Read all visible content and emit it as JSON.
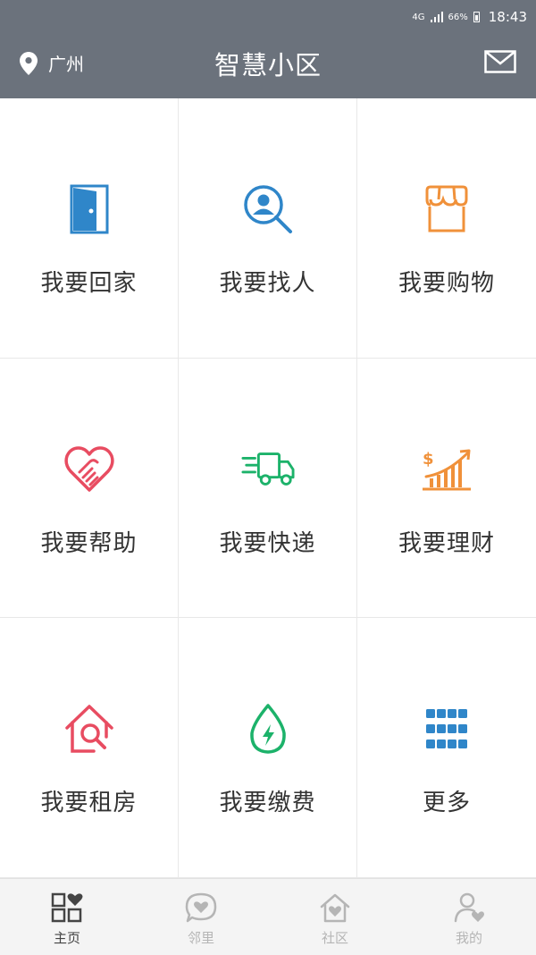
{
  "status_bar": {
    "network": "4G",
    "battery": "66%",
    "time": "18:43"
  },
  "header": {
    "location": "广州",
    "title": "智慧小区",
    "mail_icon": "mail-icon",
    "location_icon": "location-pin-icon"
  },
  "grid": [
    {
      "label": "我要回家",
      "icon": "door-icon",
      "color": "#2f86c9"
    },
    {
      "label": "我要找人",
      "icon": "search-person-icon",
      "color": "#2f86c9"
    },
    {
      "label": "我要购物",
      "icon": "shop-icon",
      "color": "#f0913a"
    },
    {
      "label": "我要帮助",
      "icon": "handshake-heart-icon",
      "color": "#e84c61"
    },
    {
      "label": "我要快递",
      "icon": "delivery-truck-icon",
      "color": "#1cb26a"
    },
    {
      "label": "我要理财",
      "icon": "finance-chart-icon",
      "color": "#f0913a"
    },
    {
      "label": "我要租房",
      "icon": "house-search-icon",
      "color": "#e84c61"
    },
    {
      "label": "我要缴费",
      "icon": "energy-drop-icon",
      "color": "#1cb26a"
    },
    {
      "label": "更多",
      "icon": "grid-more-icon",
      "color": "#2f86c9"
    }
  ],
  "tabs": [
    {
      "label": "主页",
      "icon": "home-grid-icon",
      "active": true
    },
    {
      "label": "邻里",
      "icon": "chat-heart-icon",
      "active": false
    },
    {
      "label": "社区",
      "icon": "house-heart-icon",
      "active": false
    },
    {
      "label": "我的",
      "icon": "person-heart-icon",
      "active": false
    }
  ]
}
